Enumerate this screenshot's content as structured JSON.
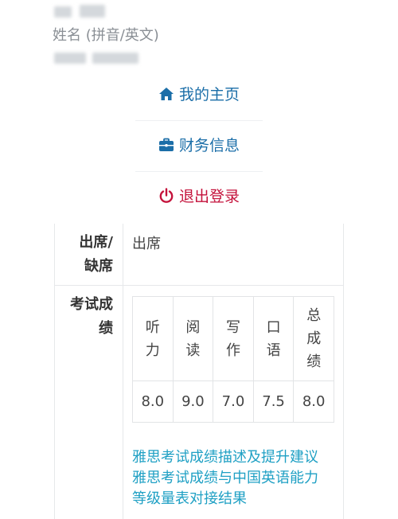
{
  "header": {
    "name_label": "姓名 (拼音/英文)"
  },
  "nav": {
    "home": {
      "label": "我的主页",
      "icon": "home-icon"
    },
    "finance": {
      "label": "财务信息",
      "icon": "briefcase-icon"
    },
    "logout": {
      "label": "退出登录",
      "icon": "power-icon"
    }
  },
  "details": {
    "attendance": {
      "label_line1": "出席/",
      "label_line2": "缺席",
      "value": "出席"
    },
    "scores": {
      "label_line1": "考试成",
      "label_line2": "绩",
      "columns": [
        {
          "header": "听力",
          "value": "8.0"
        },
        {
          "header": "阅读",
          "value": "9.0"
        },
        {
          "header": "写作",
          "value": "7.0"
        },
        {
          "header": "口语",
          "value": "7.5"
        },
        {
          "header": "总成绩",
          "value": "8.0"
        }
      ]
    }
  },
  "links": {
    "description": "雅思考试成绩描述及提升建议",
    "cse_line1": "雅思考试成绩与中国英语能力",
    "cse_line2": "等级量表对接结果"
  },
  "colors": {
    "nav_blue": "#1b6ea8",
    "logout_red": "#c4123b",
    "link_teal": "#1fa0c4"
  }
}
